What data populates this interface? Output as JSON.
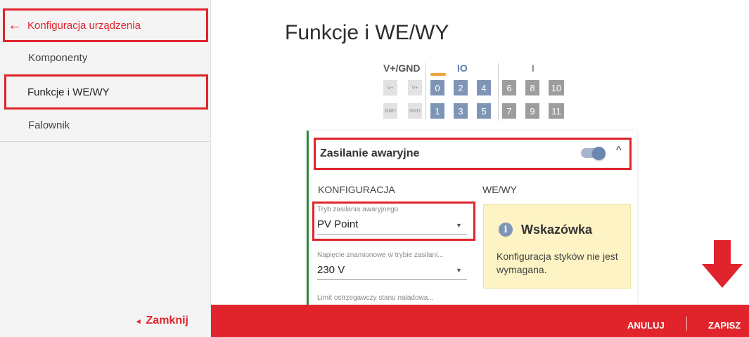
{
  "sidebar": {
    "back_label": "Konfiguracja urządzenia",
    "items": [
      {
        "label": "Komponenty"
      },
      {
        "label": "Funkcje i WE/WY"
      },
      {
        "label": "Falownik"
      }
    ],
    "close_label": "Zamknij"
  },
  "main": {
    "title": "Funkcje i WE/WY",
    "io_panel": {
      "group_vgnd": "V+/GND",
      "group_io": "IO",
      "group_i": "I",
      "vplus_label": "V+",
      "gnd_label": "GND",
      "io_top": [
        "0",
        "2",
        "4"
      ],
      "io_bottom": [
        "1",
        "3",
        "5"
      ],
      "i_top": [
        "6",
        "8",
        "10"
      ],
      "i_bottom": [
        "7",
        "9",
        "11"
      ]
    },
    "card": {
      "title": "Zasilanie awaryjne",
      "toggle_on": true,
      "section_config": "KONFIGURACJA",
      "section_io": "WE/WY",
      "fields": [
        {
          "label": "Tryb zasilania awaryjnego",
          "value": "PV Point"
        },
        {
          "label": "Napięcie znamionowe w trybie zasilani...",
          "value": "230 V"
        },
        {
          "label": "Limit ostrzegawczy stanu naładowa..."
        }
      ],
      "hint": {
        "title": "Wskazówka",
        "text": "Konfiguracja styków nie jest wymagana.",
        "icon": "info-icon"
      }
    }
  },
  "footer": {
    "cancel_label": "ANULUJ",
    "save_label": "ZAPISZ"
  },
  "colors": {
    "accent_red": "#e1242c",
    "io_blue": "#7f95b6",
    "hint_bg": "#fdf3c4",
    "card_border_green": "#2e8a3e"
  }
}
